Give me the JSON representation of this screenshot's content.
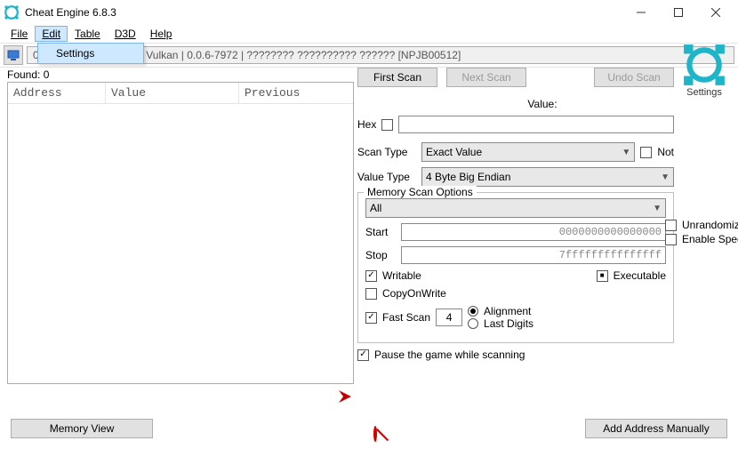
{
  "window": {
    "title": "Cheat Engine 6.8.3"
  },
  "menu": {
    "file": "File",
    "edit": "Edit",
    "table": "Table",
    "d3d": "D3D",
    "help": "Help",
    "edit_dropdown": {
      "settings": "Settings"
    }
  },
  "toolbar": {
    "status": "00004908-FPS: 16.34 | Vulkan | 0.0.6-7972 | ???????? ?????????? ?????? [NPJB00512]",
    "settings_caption": "Settings"
  },
  "left": {
    "found": "Found: 0",
    "col_address": "Address",
    "col_value": "Value",
    "col_previous": "Previous",
    "memory_view": "Memory View"
  },
  "right": {
    "first_scan": "First Scan",
    "next_scan": "Next Scan",
    "undo_scan": "Undo Scan",
    "value_label": "Value:",
    "hex_label": "Hex",
    "value_input": "",
    "scan_type_label": "Scan Type",
    "scan_type_value": "Exact Value",
    "not_label": "Not",
    "value_type_label": "Value Type",
    "value_type_value": "4 Byte Big Endian",
    "memory_scan_options": "Memory Scan Options",
    "region_select": "All",
    "start_label": "Start",
    "start_value": "0000000000000000",
    "stop_label": "Stop",
    "stop_value": "7fffffffffffffff",
    "writable_label": "Writable",
    "executable_label": "Executable",
    "copyonwrite_label": "CopyOnWrite",
    "fast_scan_label": "Fast Scan",
    "fast_scan_value": "4",
    "alignment_label": "Alignment",
    "last_digits_label": "Last Digits",
    "pause_label": "Pause the game while scanning",
    "unrandomizer_label": "Unrandomizer",
    "speedhack_label": "Enable Speedhack",
    "add_address": "Add Address Manually"
  }
}
